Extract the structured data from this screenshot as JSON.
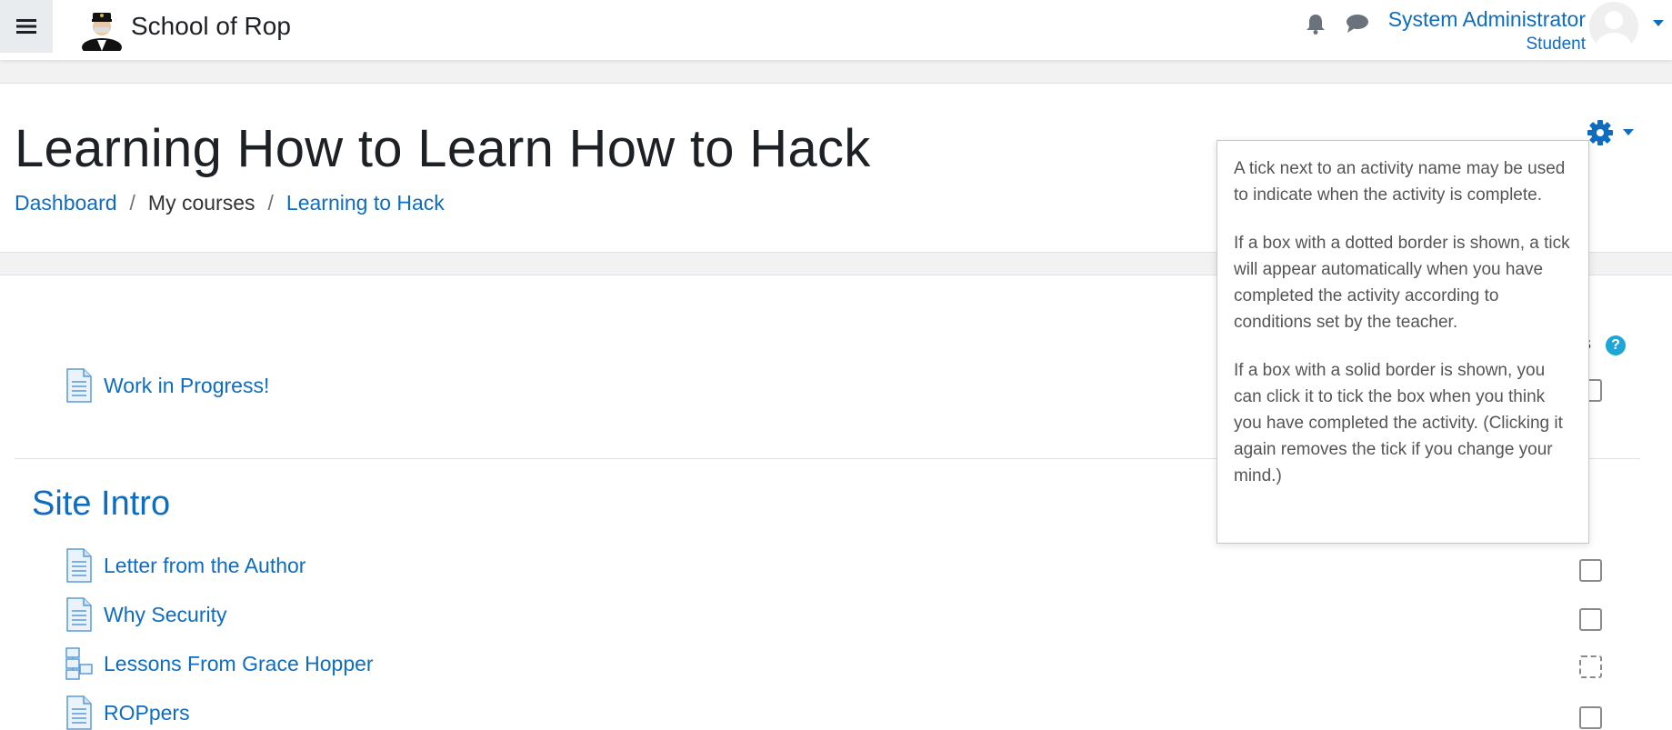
{
  "navbar": {
    "site_name": "School of Rop",
    "user_name": "System Administrator",
    "user_role": "Student",
    "icons": [
      "menu-icon",
      "bell-icon",
      "chat-icon",
      "avatar",
      "caret-down-icon"
    ]
  },
  "header": {
    "title": "Learning How to Learn How to Hack",
    "breadcrumb": {
      "dashboard": "Dashboard",
      "my_courses": "My courses",
      "course": "Learning to Hack",
      "separator": "/"
    }
  },
  "content": {
    "top_activity": "Work in Progress!",
    "section_title": "Site Intro",
    "activities": [
      {
        "label": "Letter from the Author"
      },
      {
        "label": "Why Security"
      },
      {
        "label": "Lessons From Grace Hopper"
      },
      {
        "label": "ROPpers"
      }
    ],
    "progress_help": "?",
    "progress_text_fragment": "s"
  },
  "popover": {
    "p1": "A tick next to an activity name may be used to indicate when the activity is complete.",
    "p2": "If a box with a dotted border is shown, a tick will appear automatically when you have completed the activity according to conditions set by the teacher.",
    "p3": "If a box with a solid border is shown, you can click it to tick the box when you think you have completed the activity. (Clicking it again removes the tick if you change your mind.)"
  },
  "colors": {
    "link": "#0f6cbf",
    "text": "#1d2125",
    "help_badge": "#1fa6d6"
  }
}
